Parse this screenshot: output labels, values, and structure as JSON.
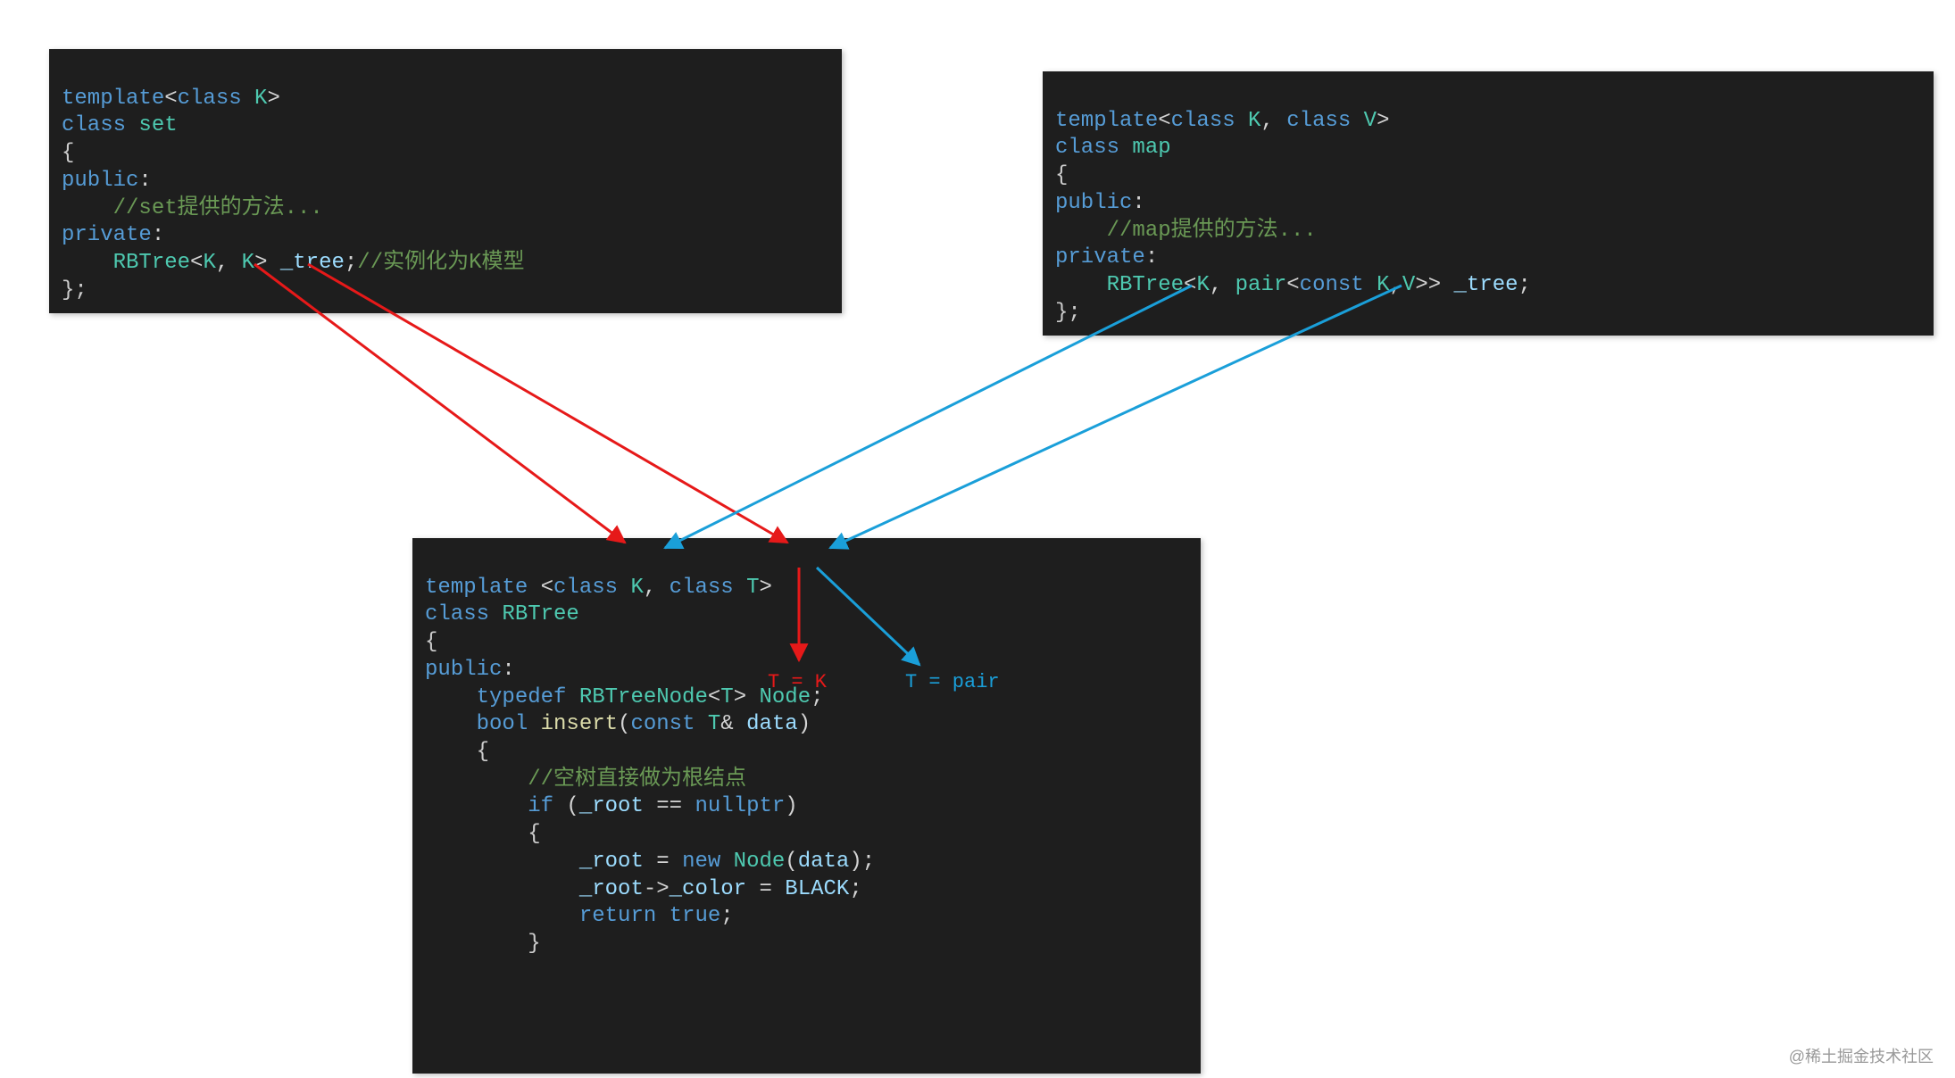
{
  "set_box": {
    "l1_template": "template",
    "l1_open": "<",
    "l1_class": "class",
    "l1_K": " K",
    "l1_close": ">",
    "l2_class": "class",
    "l2_name": " set",
    "l3": "{",
    "l4_public": "public",
    "l4_colon": ":",
    "l5_comment": "//set提供的方法...",
    "l6_private": "private",
    "l6_colon": ":",
    "l7_type": "RBTree",
    "l7_open": "<",
    "l7_K1": "K",
    "l7_comma": ", ",
    "l7_K2": "K",
    "l7_close": ">",
    "l7_var": " _tree",
    "l7_semi": ";",
    "l7_comment": "//实例化为K模型",
    "l8": "};"
  },
  "map_box": {
    "l1_template": "template",
    "l1_open": "<",
    "l1_class1": "class",
    "l1_K": " K",
    "l1_comma": ", ",
    "l1_class2": "class",
    "l1_V": " V",
    "l1_close": ">",
    "l2_class": "class",
    "l2_name": " map",
    "l3": "{",
    "l4_public": "public",
    "l4_colon": ":",
    "l5_comment": "//map提供的方法...",
    "l6_private": "private",
    "l6_colon": ":",
    "l7_type": "RBTree",
    "l7_open": "<",
    "l7_K": "K",
    "l7_comma1": ", ",
    "l7_pair": "pair",
    "l7_open2": "<",
    "l7_const": "const",
    "l7_K2": " K",
    "l7_comma2": ",",
    "l7_V": "V",
    "l7_close2": ">>",
    "l7_var": " _tree",
    "l7_semi": ";",
    "l8": "};"
  },
  "rbtree_box": {
    "l1_template": "template",
    "l1_sp": " ",
    "l1_open": "<",
    "l1_class1": "class",
    "l1_K": " K",
    "l1_comma": ", ",
    "l1_class2": "class",
    "l1_T": " T",
    "l1_close": ">",
    "l2_class": "class",
    "l2_name": " RBTree",
    "l3": "{",
    "l4_public": "public",
    "l4_colon": ":",
    "l5_typedef": "typedef",
    "l5_node": " RBTreeNode",
    "l5_open": "<",
    "l5_T": "T",
    "l5_close": ">",
    "l5_alias": " Node",
    "l5_semi": ";",
    "l6_bool": "bool",
    "l6_fn": " insert",
    "l6_open": "(",
    "l6_const": "const",
    "l6_T": " T",
    "l6_amp": "& ",
    "l6_param": "data",
    "l6_close": ")",
    "l7": "{",
    "l8_comment": "//空树直接做为根结点",
    "l9_if": "if",
    "l9_open": " (",
    "l9_root": "_root",
    "l9_eq": " == ",
    "l9_null": "nullptr",
    "l9_close": ")",
    "l10": "{",
    "l11_root": "_root",
    "l11_eq": " = ",
    "l11_new": "new",
    "l11_node": " Node",
    "l11_open": "(",
    "l11_arg": "data",
    "l11_close": ");",
    "l12_root": "_root",
    "l12_arrow": "->",
    "l12_color": "_color",
    "l12_eq": " = ",
    "l12_black": "BLACK",
    "l12_semi": ";",
    "l13_return": "return",
    "l13_true": " true",
    "l13_semi": ";",
    "l14": "}"
  },
  "annotations": {
    "t_eq_k": "T = K",
    "t_eq_pair": "T = pair"
  },
  "watermark": "@稀土掘金技术社区"
}
